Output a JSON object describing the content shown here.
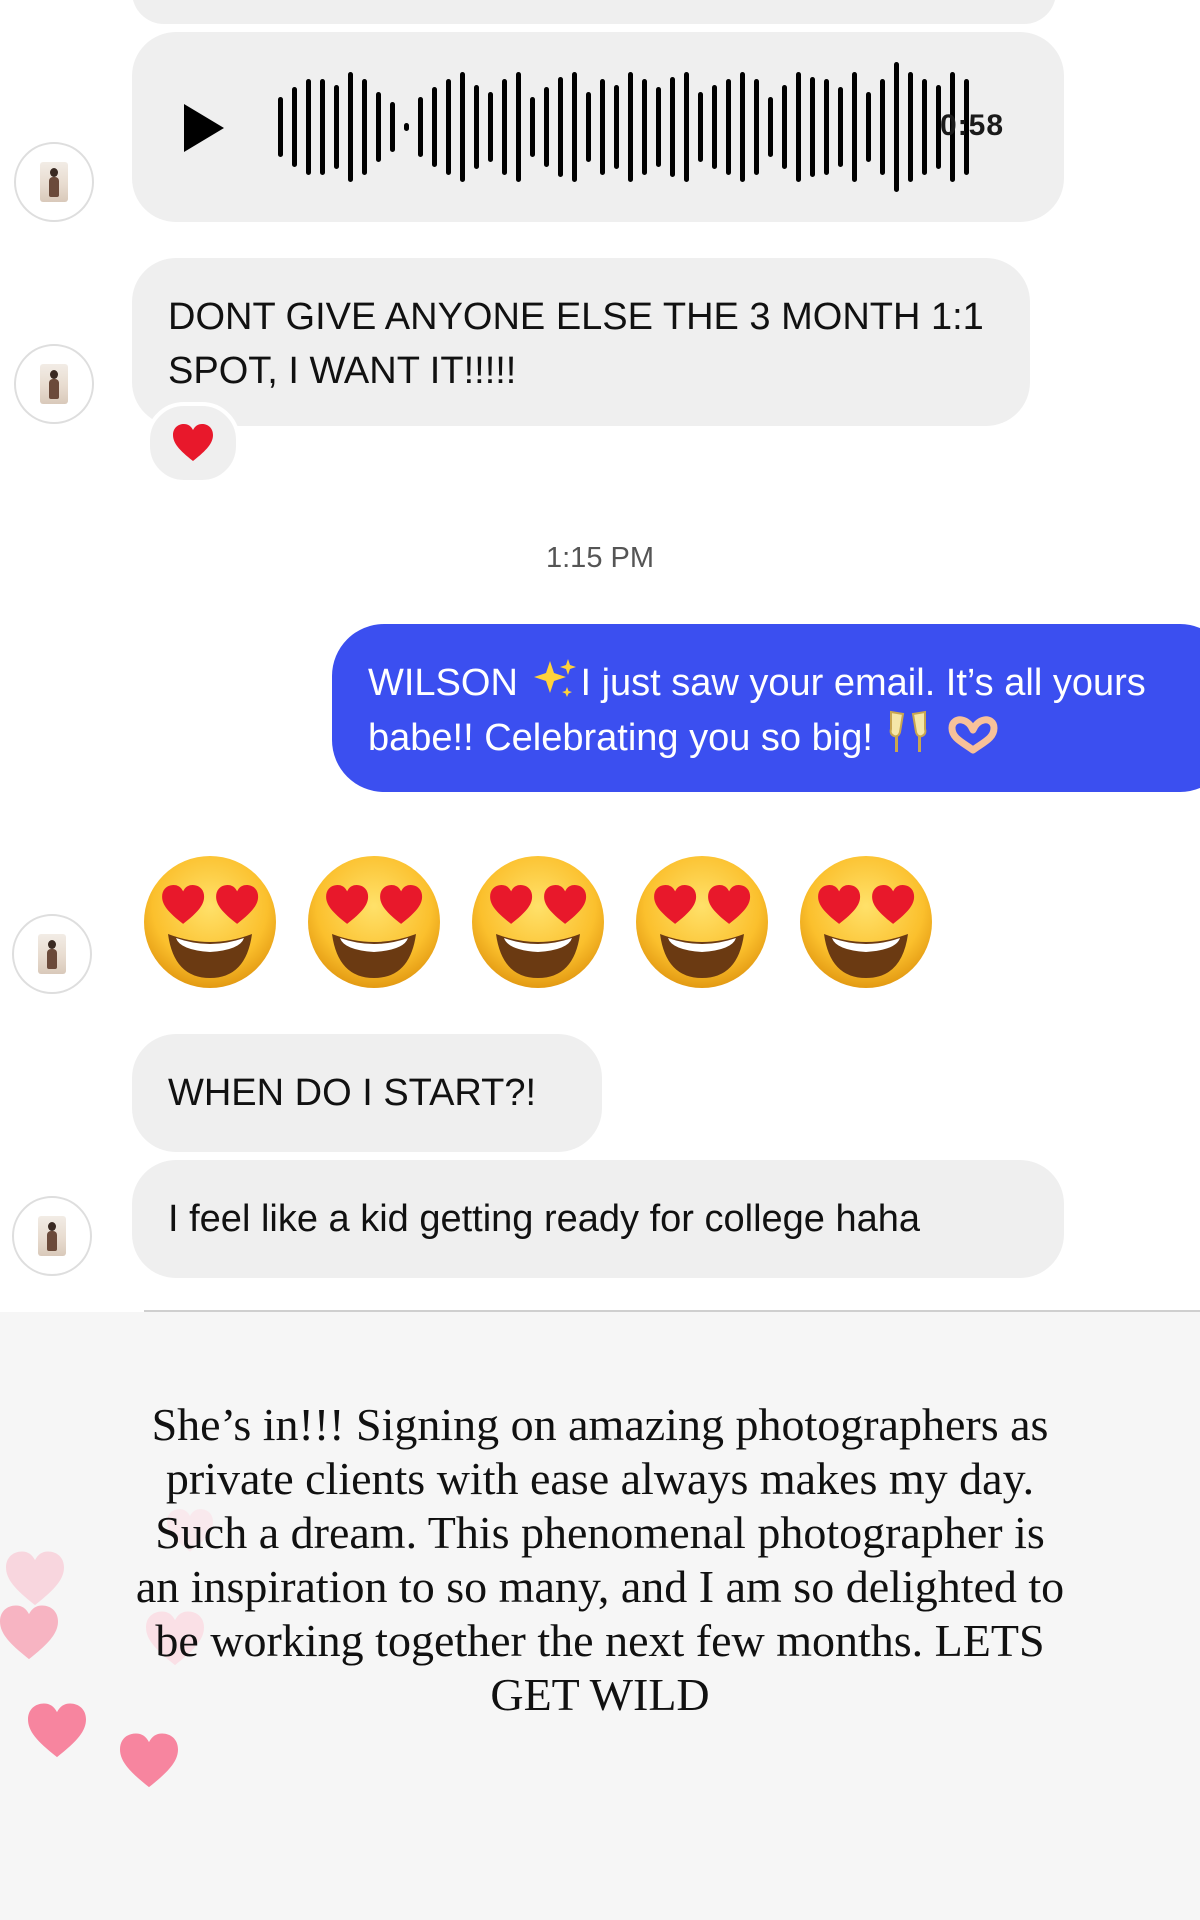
{
  "voice_message": {
    "duration": "0:58"
  },
  "messages": {
    "received_1": "DONT GIVE ANYONE ELSE THE 3 MONTH 1:1 SPOT, I WANT IT!!!!!",
    "received_1_reaction": "heart",
    "timestamp": "1:15 PM",
    "sent_part1": "WILSON",
    "sent_part2": "I just saw your email. It’s all yours babe!! Celebrating you so big!",
    "received_emoji_count": 5,
    "received_2": "WHEN DO I START?!",
    "received_3": "I feel like a kid getting ready for college haha"
  },
  "caption": {
    "text": "She’s in!!! Signing on amazing photographers as private clients with ease always makes my day. Such a dream. This phenomenal photographer is an inspiration to so many, and I am so delighted to be working together the next few months. LETS GET WILD"
  },
  "colors": {
    "sent_bubble": "#3b4ff0",
    "received_bubble": "#efefef",
    "heart_pink": "#f7859f",
    "caption_background": "#f6f6f6"
  },
  "icons": [
    "play-icon",
    "waveform-icon",
    "sparkles-icon",
    "clinking-glasses-icon",
    "heart-hands-icon",
    "heart-eyes-emoji",
    "red-heart-icon"
  ]
}
